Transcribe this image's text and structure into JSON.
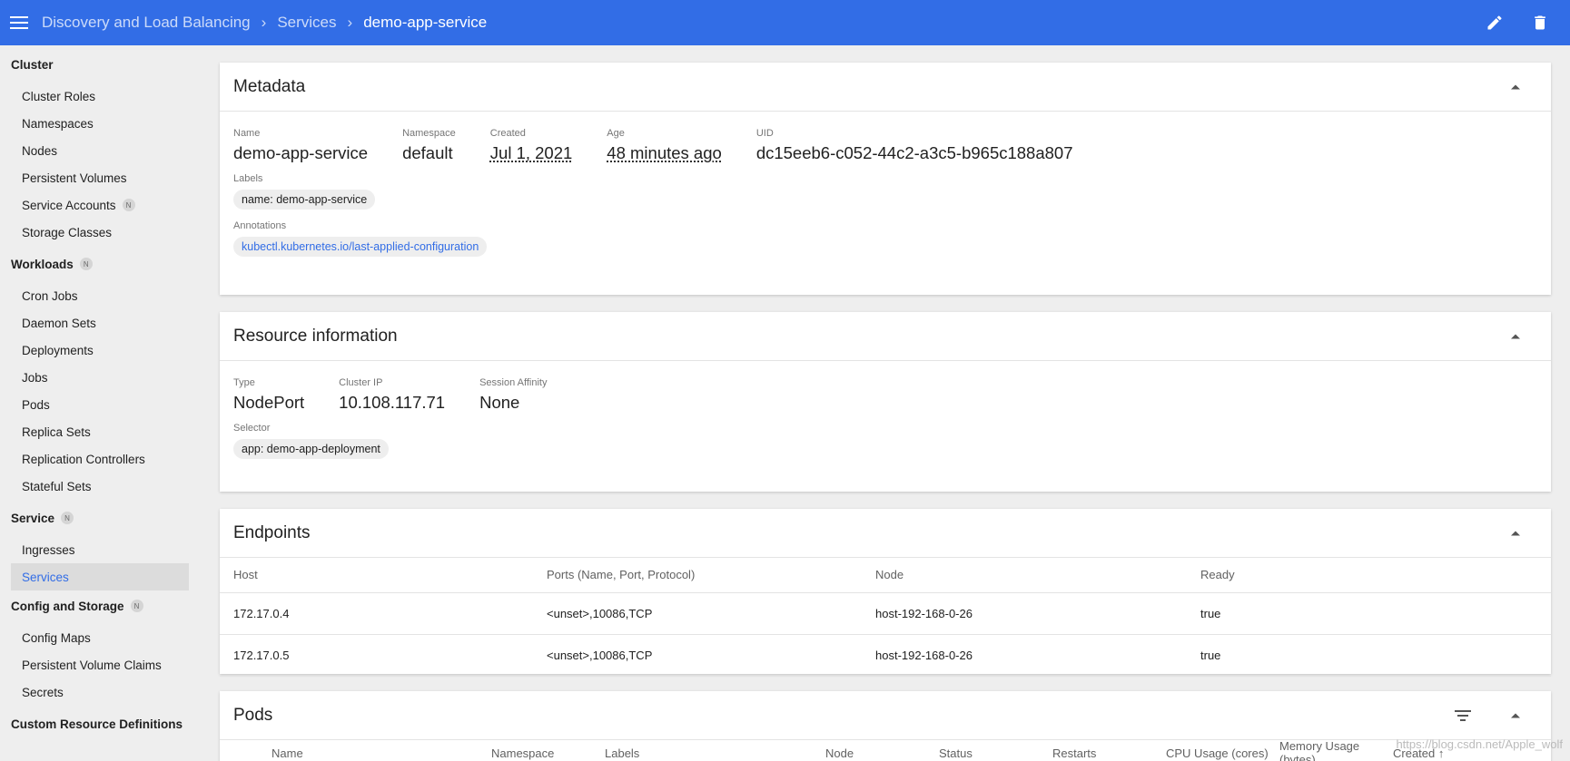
{
  "header": {
    "breadcrumbs": [
      "Discovery and Load Balancing",
      "Services"
    ],
    "current": "demo-app-service",
    "menu_icon": "menu-icon",
    "edit_icon": "pencil-icon",
    "delete_icon": "trash-icon",
    "color": "#326de6"
  },
  "sidebar": {
    "cluster": {
      "label": "Cluster",
      "items": [
        "Cluster Roles",
        "Namespaces",
        "Nodes",
        "Persistent Volumes",
        "Service Accounts",
        "Storage Classes"
      ]
    },
    "workloads": {
      "label": "Workloads",
      "items": [
        "Cron Jobs",
        "Daemon Sets",
        "Deployments",
        "Jobs",
        "Pods",
        "Replica Sets",
        "Replication Controllers",
        "Stateful Sets"
      ]
    },
    "service": {
      "label": "Service",
      "items": [
        "Ingresses",
        "Services"
      ]
    },
    "config": {
      "label": "Config and Storage",
      "items": [
        "Config Maps",
        "Persistent Volume Claims",
        "Secrets"
      ]
    },
    "crd": {
      "label": "Custom Resource Definitions"
    },
    "badge": "N"
  },
  "metadata": {
    "title": "Metadata",
    "name_label": "Name",
    "name": "demo-app-service",
    "namespace_label": "Namespace",
    "namespace": "default",
    "created_label": "Created",
    "created": "Jul 1, 2021",
    "age_label": "Age",
    "age": "48 minutes ago",
    "uid_label": "UID",
    "uid": "dc15eeb6-c052-44c2-a3c5-b965c188a807",
    "labels_label": "Labels",
    "label_chip": "name: demo-app-service",
    "annotations_label": "Annotations",
    "annotation_chip": "kubectl.kubernetes.io/last-applied-configuration"
  },
  "resource": {
    "title": "Resource information",
    "type_label": "Type",
    "type": "NodePort",
    "ip_label": "Cluster IP",
    "ip": "10.108.117.71",
    "affinity_label": "Session Affinity",
    "affinity": "None",
    "selector_label": "Selector",
    "selector_chip": "app: demo-app-deployment"
  },
  "endpoints": {
    "title": "Endpoints",
    "columns": [
      "Host",
      "Ports (Name, Port, Protocol)",
      "Node",
      "Ready"
    ],
    "rows": [
      [
        "172.17.0.4",
        "<unset>,10086,TCP",
        "host-192-168-0-26",
        "true"
      ],
      [
        "172.17.0.5",
        "<unset>,10086,TCP",
        "host-192-168-0-26",
        "true"
      ]
    ]
  },
  "pods": {
    "title": "Pods",
    "columns": [
      "Name",
      "Namespace",
      "Labels",
      "Node",
      "Status",
      "Restarts",
      "CPU Usage (cores)",
      "Memory Usage (bytes)",
      "Created"
    ]
  },
  "watermark": "https://blog.csdn.net/Apple_wolf"
}
